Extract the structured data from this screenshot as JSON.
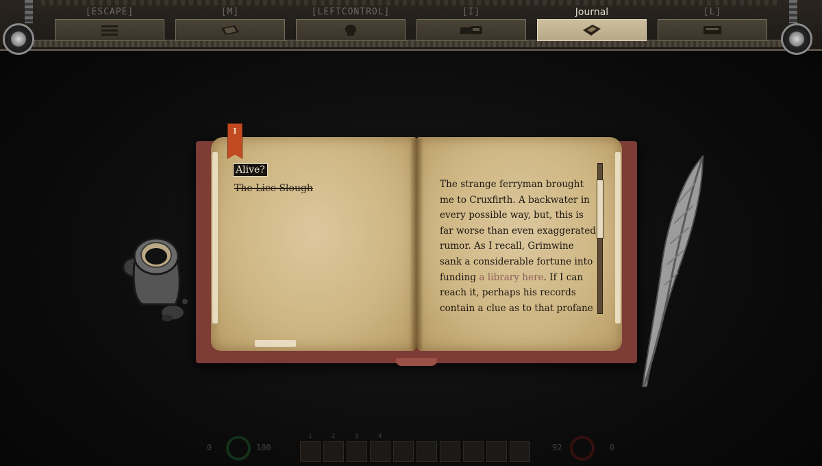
{
  "tabs": [
    {
      "hotkey": "[ESCAPE]",
      "icon": "menu-icon",
      "active": false
    },
    {
      "hotkey": "[M]",
      "icon": "map-icon",
      "active": false
    },
    {
      "hotkey": "[LEFTCONTROL]",
      "icon": "skull-icon",
      "active": false
    },
    {
      "hotkey": "[I]",
      "icon": "inventory-icon",
      "active": false
    },
    {
      "hotkey": "Journal",
      "icon": "journal-icon",
      "active": true
    },
    {
      "hotkey": "[L]",
      "icon": "lore-book-icon",
      "active": false
    }
  ],
  "journal": {
    "bookmark_label": "I",
    "entries": [
      {
        "title": "Alive?",
        "selected": true,
        "completed": false
      },
      {
        "title": "The Lice Slough",
        "selected": false,
        "completed": true
      }
    ],
    "text_before_link": "The strange ferryman brought me to Cruxfirth. A backwater in every possible way, but, this is far worse than even exaggerated rumor. As I recall, Grimwine sank a considerable fortune into funding ",
    "link_text": "a library here",
    "text_after_link": ". If I can reach it, perhaps his records contain a clue as to that profane ritual I disrupted."
  },
  "hud": {
    "left_min": "0",
    "left_max": "100",
    "right_value": "92",
    "right_min": "0",
    "hotbar_numbers": [
      "1",
      "2",
      "3",
      "4"
    ]
  },
  "colors": {
    "cover": "#7d3c36",
    "parchment": "#cfb784",
    "bookmark": "#c24a22",
    "link": "#8c5b56",
    "active_tab": "#cdbf9e"
  }
}
